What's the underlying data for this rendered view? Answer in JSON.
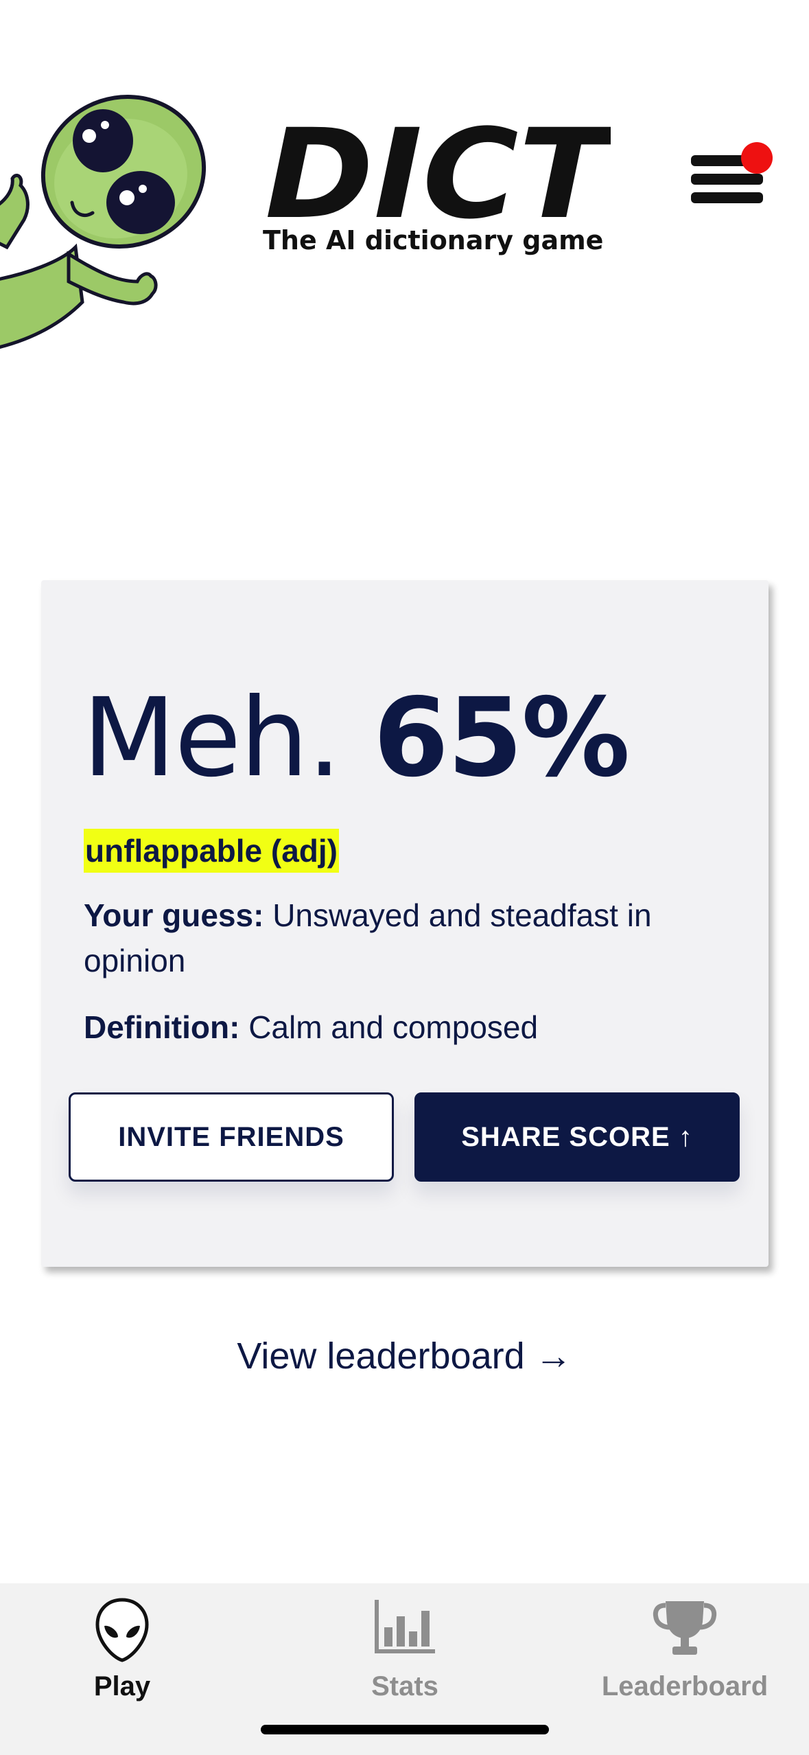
{
  "header": {
    "logo_text": "DICT",
    "tagline": "The AI dictionary game",
    "menu_icon": "hamburger-menu-icon",
    "notification_dot_color": "#ee1111",
    "mascot": "alien-mascot"
  },
  "result": {
    "verdict": "Meh.",
    "score": "65%",
    "word": "unflappable (adj)",
    "guess_label": "Your guess:",
    "guess_text": "Unswayed and steadfast in opinion",
    "definition_label": "Definition:",
    "definition_text": "Calm and composed",
    "highlight_color": "#f1ff14"
  },
  "actions": {
    "invite_label": "INVITE FRIENDS",
    "share_label": "SHARE SCORE ↑"
  },
  "links": {
    "view_leaderboard": "View leaderboard →"
  },
  "tabbar": {
    "active": "Play",
    "tabs": [
      {
        "label": "Play",
        "icon": "alien-head-icon"
      },
      {
        "label": "Stats",
        "icon": "bar-chart-icon"
      },
      {
        "label": "Leaderboard",
        "icon": "trophy-icon"
      }
    ]
  },
  "colors": {
    "primary": "#0d1844",
    "card_background": "#f2f2f4",
    "inactive_tab": "#8e8e8e"
  }
}
